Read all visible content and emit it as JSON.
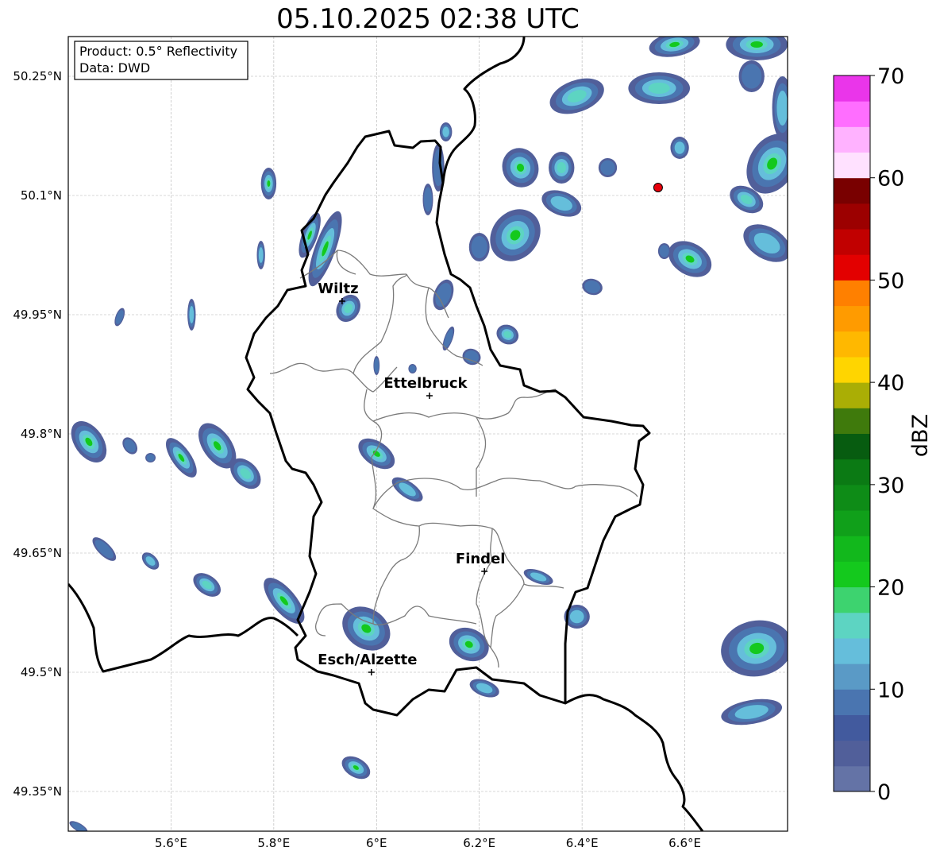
{
  "title": "05.10.2025 02:38 UTC",
  "info": {
    "product": "Product: 0.5° Reflectivity",
    "source": "Data: DWD"
  },
  "axes": {
    "lon_range": [
      5.4,
      6.8
    ],
    "lat_range": [
      49.3,
      50.3
    ],
    "x_ticks": [
      {
        "value": 5.6,
        "label": "5.6°E"
      },
      {
        "value": 5.8,
        "label": "5.8°E"
      },
      {
        "value": 6.0,
        "label": "6°E"
      },
      {
        "value": 6.2,
        "label": "6.2°E"
      },
      {
        "value": 6.4,
        "label": "6.4°E"
      },
      {
        "value": 6.6,
        "label": "6.6°E"
      }
    ],
    "y_ticks": [
      {
        "value": 50.25,
        "label": "50.25°N"
      },
      {
        "value": 50.1,
        "label": "50.1°N"
      },
      {
        "value": 49.95,
        "label": "49.95°N"
      },
      {
        "value": 49.8,
        "label": "49.8°N"
      },
      {
        "value": 49.65,
        "label": "49.65°N"
      },
      {
        "value": 49.5,
        "label": "49.5°N"
      },
      {
        "value": 49.35,
        "label": "49.35°N"
      }
    ],
    "grid": true
  },
  "cities": [
    {
      "name": "Wiltz",
      "lon": 5.933,
      "lat": 49.967
    },
    {
      "name": "Ettelbruck",
      "lon": 6.103,
      "lat": 49.848
    },
    {
      "name": "Findel",
      "lon": 6.21,
      "lat": 49.627
    },
    {
      "name": "Esch/Alzette",
      "lon": 5.99,
      "lat": 49.5
    }
  ],
  "radar_site": {
    "lon": 6.548,
    "lat": 50.11,
    "color": "#e8000b"
  },
  "colorbar": {
    "label": "dBZ",
    "ticks": [
      "0",
      "10",
      "20",
      "30",
      "40",
      "50",
      "60",
      "70"
    ],
    "min": 0,
    "max": 70,
    "colors": [
      "#6473a6",
      "#515f9a",
      "#425a9e",
      "#4a75b0",
      "#5a9ac6",
      "#65bedb",
      "#5dd4c2",
      "#3dd36f",
      "#14c91d",
      "#12b81c",
      "#10a01a",
      "#0e8c17",
      "#0b7a14",
      "#075c10",
      "#3f7a0c",
      "#aaae05",
      "#ffd500",
      "#ffb800",
      "#ff9b00",
      "#ff8000",
      "#e30000",
      "#c10000",
      "#9c0000",
      "#790000",
      "#ffe1ff",
      "#ffb2ff",
      "#ff6eff",
      "#ea35ea"
    ]
  },
  "precip_cells": [
    {
      "lon": 5.9,
      "lat": 50.033,
      "rx": 0.02,
      "ry": 0.05,
      "angle": 20,
      "max_dbz": 25
    },
    {
      "lon": 5.87,
      "lat": 50.05,
      "rx": 0.015,
      "ry": 0.03,
      "angle": 20,
      "max_dbz": 30
    },
    {
      "lon": 5.79,
      "lat": 50.115,
      "rx": 0.015,
      "ry": 0.02,
      "angle": 0,
      "max_dbz": 25
    },
    {
      "lon": 5.775,
      "lat": 50.025,
      "rx": 0.008,
      "ry": 0.018,
      "angle": 0,
      "max_dbz": 15
    },
    {
      "lon": 5.945,
      "lat": 49.958,
      "rx": 0.022,
      "ry": 0.018,
      "angle": 30,
      "max_dbz": 18
    },
    {
      "lon": 5.5,
      "lat": 49.947,
      "rx": 0.008,
      "ry": 0.012,
      "angle": 20,
      "max_dbz": 10
    },
    {
      "lon": 5.64,
      "lat": 49.95,
      "rx": 0.008,
      "ry": 0.02,
      "angle": 0,
      "max_dbz": 15
    },
    {
      "lon": 6.0,
      "lat": 49.886,
      "rx": 0.006,
      "ry": 0.012,
      "angle": 0,
      "max_dbz": 10
    },
    {
      "lon": 6.07,
      "lat": 49.882,
      "rx": 0.008,
      "ry": 0.006,
      "angle": 0,
      "max_dbz": 10
    },
    {
      "lon": 6.13,
      "lat": 49.975,
      "rx": 0.018,
      "ry": 0.02,
      "angle": 20,
      "max_dbz": 12
    },
    {
      "lon": 6.14,
      "lat": 49.92,
      "rx": 0.008,
      "ry": 0.016,
      "angle": 20,
      "max_dbz": 12
    },
    {
      "lon": 6.185,
      "lat": 49.897,
      "rx": 0.018,
      "ry": 0.01,
      "angle": 20,
      "max_dbz": 12
    },
    {
      "lon": 6.255,
      "lat": 49.925,
      "rx": 0.022,
      "ry": 0.012,
      "angle": 25,
      "max_dbz": 20
    },
    {
      "lon": 6.12,
      "lat": 50.135,
      "rx": 0.012,
      "ry": 0.03,
      "angle": 0,
      "max_dbz": 10
    },
    {
      "lon": 6.135,
      "lat": 50.18,
      "rx": 0.012,
      "ry": 0.012,
      "angle": 0,
      "max_dbz": 15
    },
    {
      "lon": 6.1,
      "lat": 50.095,
      "rx": 0.01,
      "ry": 0.02,
      "angle": 0,
      "max_dbz": 10
    },
    {
      "lon": 6.27,
      "lat": 50.05,
      "rx": 0.045,
      "ry": 0.035,
      "angle": 40,
      "max_dbz": 25
    },
    {
      "lon": 6.2,
      "lat": 50.035,
      "rx": 0.02,
      "ry": 0.018,
      "angle": 0,
      "max_dbz": 10
    },
    {
      "lon": 6.28,
      "lat": 50.135,
      "rx": 0.035,
      "ry": 0.025,
      "angle": -20,
      "max_dbz": 25
    },
    {
      "lon": 6.36,
      "lat": 50.135,
      "rx": 0.025,
      "ry": 0.02,
      "angle": 0,
      "max_dbz": 20
    },
    {
      "lon": 6.36,
      "lat": 50.09,
      "rx": 0.04,
      "ry": 0.015,
      "angle": 20,
      "max_dbz": 15
    },
    {
      "lon": 6.45,
      "lat": 50.135,
      "rx": 0.018,
      "ry": 0.012,
      "angle": 0,
      "max_dbz": 12
    },
    {
      "lon": 6.42,
      "lat": 49.985,
      "rx": 0.02,
      "ry": 0.01,
      "angle": 15,
      "max_dbz": 10
    },
    {
      "lon": 6.39,
      "lat": 50.225,
      "rx": 0.055,
      "ry": 0.02,
      "angle": -20,
      "max_dbz": 20
    },
    {
      "lon": 6.55,
      "lat": 50.235,
      "rx": 0.06,
      "ry": 0.02,
      "angle": 0,
      "max_dbz": 20
    },
    {
      "lon": 6.73,
      "lat": 50.25,
      "rx": 0.025,
      "ry": 0.02,
      "angle": 0,
      "max_dbz": 12
    },
    {
      "lon": 6.58,
      "lat": 50.29,
      "rx": 0.05,
      "ry": 0.015,
      "angle": -10,
      "max_dbz": 25
    },
    {
      "lon": 6.74,
      "lat": 50.29,
      "rx": 0.06,
      "ry": 0.02,
      "angle": 0,
      "max_dbz": 25
    },
    {
      "lon": 6.59,
      "lat": 50.16,
      "rx": 0.018,
      "ry": 0.014,
      "angle": 0,
      "max_dbz": 15
    },
    {
      "lon": 6.77,
      "lat": 50.14,
      "rx": 0.045,
      "ry": 0.04,
      "angle": 30,
      "max_dbz": 25
    },
    {
      "lon": 6.72,
      "lat": 50.095,
      "rx": 0.035,
      "ry": 0.015,
      "angle": 30,
      "max_dbz": 20
    },
    {
      "lon": 6.76,
      "lat": 50.04,
      "rx": 0.05,
      "ry": 0.02,
      "angle": 30,
      "max_dbz": 15
    },
    {
      "lon": 6.61,
      "lat": 50.02,
      "rx": 0.045,
      "ry": 0.02,
      "angle": 30,
      "max_dbz": 25
    },
    {
      "lon": 6.56,
      "lat": 50.03,
      "rx": 0.012,
      "ry": 0.01,
      "angle": 0,
      "max_dbz": 10
    },
    {
      "lon": 6.79,
      "lat": 50.21,
      "rx": 0.02,
      "ry": 0.04,
      "angle": 0,
      "max_dbz": 15
    },
    {
      "lon": 5.44,
      "lat": 49.79,
      "rx": 0.045,
      "ry": 0.018,
      "angle": 55,
      "max_dbz": 25
    },
    {
      "lon": 5.52,
      "lat": 49.785,
      "rx": 0.018,
      "ry": 0.008,
      "angle": 55,
      "max_dbz": 12
    },
    {
      "lon": 5.56,
      "lat": 49.77,
      "rx": 0.01,
      "ry": 0.006,
      "angle": 0,
      "max_dbz": 10
    },
    {
      "lon": 5.62,
      "lat": 49.77,
      "rx": 0.045,
      "ry": 0.012,
      "angle": 55,
      "max_dbz": 25
    },
    {
      "lon": 5.69,
      "lat": 49.785,
      "rx": 0.05,
      "ry": 0.018,
      "angle": 55,
      "max_dbz": 25
    },
    {
      "lon": 5.745,
      "lat": 49.75,
      "rx": 0.035,
      "ry": 0.015,
      "angle": 45,
      "max_dbz": 20
    },
    {
      "lon": 6.0,
      "lat": 49.775,
      "rx": 0.04,
      "ry": 0.015,
      "angle": 35,
      "max_dbz": 25
    },
    {
      "lon": 6.06,
      "lat": 49.73,
      "rx": 0.035,
      "ry": 0.01,
      "angle": 35,
      "max_dbz": 15
    },
    {
      "lon": 5.47,
      "lat": 49.655,
      "rx": 0.03,
      "ry": 0.008,
      "angle": 45,
      "max_dbz": 12
    },
    {
      "lon": 5.56,
      "lat": 49.64,
      "rx": 0.02,
      "ry": 0.008,
      "angle": 45,
      "max_dbz": 15
    },
    {
      "lon": 5.67,
      "lat": 49.61,
      "rx": 0.03,
      "ry": 0.012,
      "angle": 35,
      "max_dbz": 18
    },
    {
      "lon": 5.82,
      "lat": 49.59,
      "rx": 0.055,
      "ry": 0.015,
      "angle": 50,
      "max_dbz": 25
    },
    {
      "lon": 5.98,
      "lat": 49.555,
      "rx": 0.05,
      "ry": 0.025,
      "angle": 35,
      "max_dbz": 25
    },
    {
      "lon": 6.18,
      "lat": 49.535,
      "rx": 0.04,
      "ry": 0.02,
      "angle": 25,
      "max_dbz": 25
    },
    {
      "lon": 6.21,
      "lat": 49.48,
      "rx": 0.03,
      "ry": 0.01,
      "angle": 20,
      "max_dbz": 15
    },
    {
      "lon": 6.315,
      "lat": 49.62,
      "rx": 0.03,
      "ry": 0.008,
      "angle": 20,
      "max_dbz": 15
    },
    {
      "lon": 6.39,
      "lat": 49.57,
      "rx": 0.025,
      "ry": 0.015,
      "angle": 0,
      "max_dbz": 15
    },
    {
      "lon": 6.74,
      "lat": 49.53,
      "rx": 0.07,
      "ry": 0.035,
      "angle": -10,
      "max_dbz": 25
    },
    {
      "lon": 6.73,
      "lat": 49.45,
      "rx": 0.06,
      "ry": 0.015,
      "angle": -10,
      "max_dbz": 15
    },
    {
      "lon": 5.96,
      "lat": 49.38,
      "rx": 0.03,
      "ry": 0.012,
      "angle": 30,
      "max_dbz": 25
    },
    {
      "lon": 5.42,
      "lat": 49.305,
      "rx": 0.02,
      "ry": 0.005,
      "angle": 30,
      "max_dbz": 10
    }
  ]
}
